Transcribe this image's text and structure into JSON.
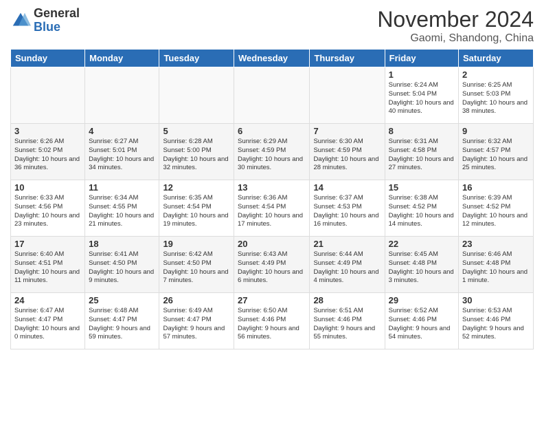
{
  "header": {
    "logo_general": "General",
    "logo_blue": "Blue",
    "month_title": "November 2024",
    "subtitle": "Gaomi, Shandong, China"
  },
  "weekdays": [
    "Sunday",
    "Monday",
    "Tuesday",
    "Wednesday",
    "Thursday",
    "Friday",
    "Saturday"
  ],
  "weeks": [
    [
      {
        "day": "",
        "info": ""
      },
      {
        "day": "",
        "info": ""
      },
      {
        "day": "",
        "info": ""
      },
      {
        "day": "",
        "info": ""
      },
      {
        "day": "",
        "info": ""
      },
      {
        "day": "1",
        "info": "Sunrise: 6:24 AM\nSunset: 5:04 PM\nDaylight: 10 hours and 40 minutes."
      },
      {
        "day": "2",
        "info": "Sunrise: 6:25 AM\nSunset: 5:03 PM\nDaylight: 10 hours and 38 minutes."
      }
    ],
    [
      {
        "day": "3",
        "info": "Sunrise: 6:26 AM\nSunset: 5:02 PM\nDaylight: 10 hours and 36 minutes."
      },
      {
        "day": "4",
        "info": "Sunrise: 6:27 AM\nSunset: 5:01 PM\nDaylight: 10 hours and 34 minutes."
      },
      {
        "day": "5",
        "info": "Sunrise: 6:28 AM\nSunset: 5:00 PM\nDaylight: 10 hours and 32 minutes."
      },
      {
        "day": "6",
        "info": "Sunrise: 6:29 AM\nSunset: 4:59 PM\nDaylight: 10 hours and 30 minutes."
      },
      {
        "day": "7",
        "info": "Sunrise: 6:30 AM\nSunset: 4:59 PM\nDaylight: 10 hours and 28 minutes."
      },
      {
        "day": "8",
        "info": "Sunrise: 6:31 AM\nSunset: 4:58 PM\nDaylight: 10 hours and 27 minutes."
      },
      {
        "day": "9",
        "info": "Sunrise: 6:32 AM\nSunset: 4:57 PM\nDaylight: 10 hours and 25 minutes."
      }
    ],
    [
      {
        "day": "10",
        "info": "Sunrise: 6:33 AM\nSunset: 4:56 PM\nDaylight: 10 hours and 23 minutes."
      },
      {
        "day": "11",
        "info": "Sunrise: 6:34 AM\nSunset: 4:55 PM\nDaylight: 10 hours and 21 minutes."
      },
      {
        "day": "12",
        "info": "Sunrise: 6:35 AM\nSunset: 4:54 PM\nDaylight: 10 hours and 19 minutes."
      },
      {
        "day": "13",
        "info": "Sunrise: 6:36 AM\nSunset: 4:54 PM\nDaylight: 10 hours and 17 minutes."
      },
      {
        "day": "14",
        "info": "Sunrise: 6:37 AM\nSunset: 4:53 PM\nDaylight: 10 hours and 16 minutes."
      },
      {
        "day": "15",
        "info": "Sunrise: 6:38 AM\nSunset: 4:52 PM\nDaylight: 10 hours and 14 minutes."
      },
      {
        "day": "16",
        "info": "Sunrise: 6:39 AM\nSunset: 4:52 PM\nDaylight: 10 hours and 12 minutes."
      }
    ],
    [
      {
        "day": "17",
        "info": "Sunrise: 6:40 AM\nSunset: 4:51 PM\nDaylight: 10 hours and 11 minutes."
      },
      {
        "day": "18",
        "info": "Sunrise: 6:41 AM\nSunset: 4:50 PM\nDaylight: 10 hours and 9 minutes."
      },
      {
        "day": "19",
        "info": "Sunrise: 6:42 AM\nSunset: 4:50 PM\nDaylight: 10 hours and 7 minutes."
      },
      {
        "day": "20",
        "info": "Sunrise: 6:43 AM\nSunset: 4:49 PM\nDaylight: 10 hours and 6 minutes."
      },
      {
        "day": "21",
        "info": "Sunrise: 6:44 AM\nSunset: 4:49 PM\nDaylight: 10 hours and 4 minutes."
      },
      {
        "day": "22",
        "info": "Sunrise: 6:45 AM\nSunset: 4:48 PM\nDaylight: 10 hours and 3 minutes."
      },
      {
        "day": "23",
        "info": "Sunrise: 6:46 AM\nSunset: 4:48 PM\nDaylight: 10 hours and 1 minute."
      }
    ],
    [
      {
        "day": "24",
        "info": "Sunrise: 6:47 AM\nSunset: 4:47 PM\nDaylight: 10 hours and 0 minutes."
      },
      {
        "day": "25",
        "info": "Sunrise: 6:48 AM\nSunset: 4:47 PM\nDaylight: 9 hours and 59 minutes."
      },
      {
        "day": "26",
        "info": "Sunrise: 6:49 AM\nSunset: 4:47 PM\nDaylight: 9 hours and 57 minutes."
      },
      {
        "day": "27",
        "info": "Sunrise: 6:50 AM\nSunset: 4:46 PM\nDaylight: 9 hours and 56 minutes."
      },
      {
        "day": "28",
        "info": "Sunrise: 6:51 AM\nSunset: 4:46 PM\nDaylight: 9 hours and 55 minutes."
      },
      {
        "day": "29",
        "info": "Sunrise: 6:52 AM\nSunset: 4:46 PM\nDaylight: 9 hours and 54 minutes."
      },
      {
        "day": "30",
        "info": "Sunrise: 6:53 AM\nSunset: 4:46 PM\nDaylight: 9 hours and 52 minutes."
      }
    ]
  ]
}
